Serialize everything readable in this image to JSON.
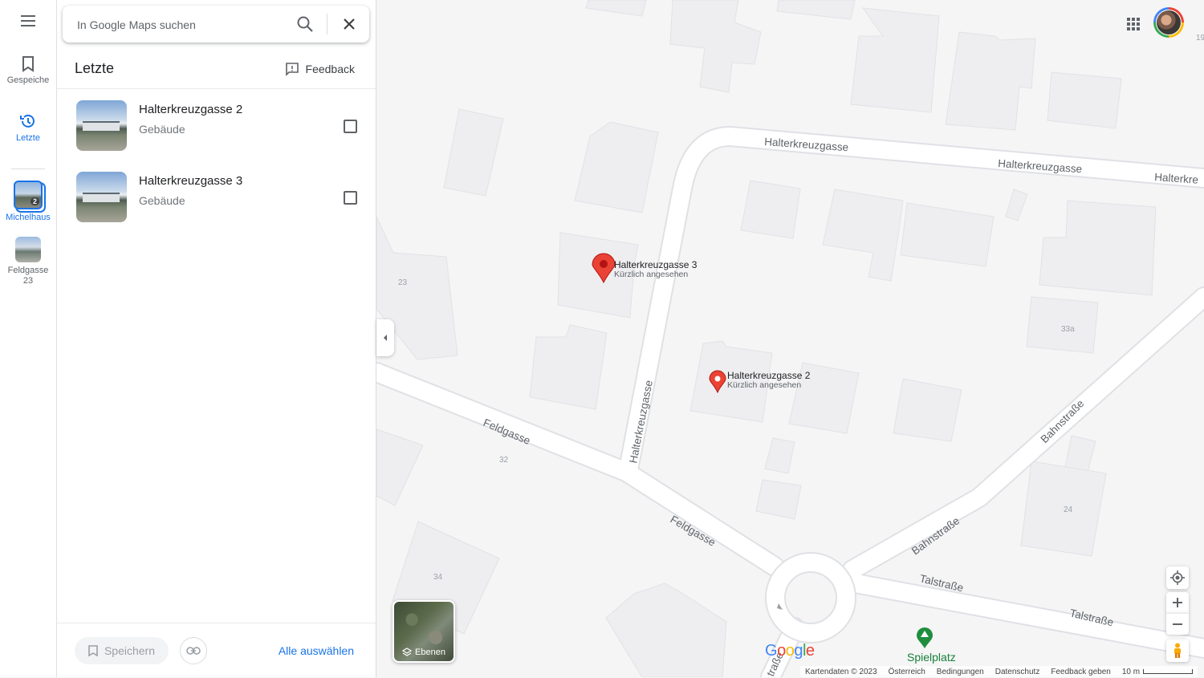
{
  "rail": {
    "saved_label": "Gespeiche",
    "recent_label": "Letzte",
    "recent_items": [
      {
        "label": "Michelhaus",
        "badge": "2"
      },
      {
        "label": "Feldgasse 23"
      }
    ]
  },
  "search": {
    "placeholder": "In Google Maps suchen"
  },
  "panel": {
    "title": "Letzte",
    "feedback_label": "Feedback",
    "items": [
      {
        "title": "Halterkreuzgasse 2",
        "subtitle": "Gebäude"
      },
      {
        "title": "Halterkreuzgasse 3",
        "subtitle": "Gebäude"
      }
    ],
    "footer": {
      "save_label": "Speichern",
      "select_all_label": "Alle auswählen"
    }
  },
  "map": {
    "streets": {
      "halterkreuzgasse_1": "Halterkreuzgasse",
      "halterkreuzgasse_2": "Halterkreuzgasse",
      "halterkreuzgasse_3": "Halterkre",
      "halterkreuzgasse_vertical": "Halterkreuzgasse",
      "feldgasse_1": "Feldgasse",
      "feldgasse_2": "Feldgasse",
      "bahnstrasse_1": "Bahnstraße",
      "bahnstrasse_2": "Bahnstraße",
      "talstrasse_1": "Talstraße",
      "talstrasse_2": "Talstraße",
      "bottom_partial": "traße"
    },
    "house_numbers": [
      "23",
      "32",
      "34",
      "33a",
      "24",
      "19"
    ],
    "pins": [
      {
        "title": "Halterkreuzgasse 3",
        "subtitle": "Kürzlich angesehen"
      },
      {
        "title": "Halterkreuzgasse 2",
        "subtitle": "Kürzlich angesehen"
      }
    ],
    "poi": {
      "label": "Spielplatz"
    },
    "layers_label": "Ebenen",
    "logo": "Google",
    "attribution": {
      "data": "Kartendaten © 2023",
      "country": "Österreich",
      "terms": "Bedingungen",
      "privacy": "Datenschutz",
      "feedback": "Feedback geben",
      "scale": "10 m"
    }
  },
  "colors": {
    "accent": "#1a73e8",
    "pin": "#ea4335",
    "road": "#ffffff",
    "building": "#eeeef0",
    "map_bg": "#f5f5f6"
  }
}
